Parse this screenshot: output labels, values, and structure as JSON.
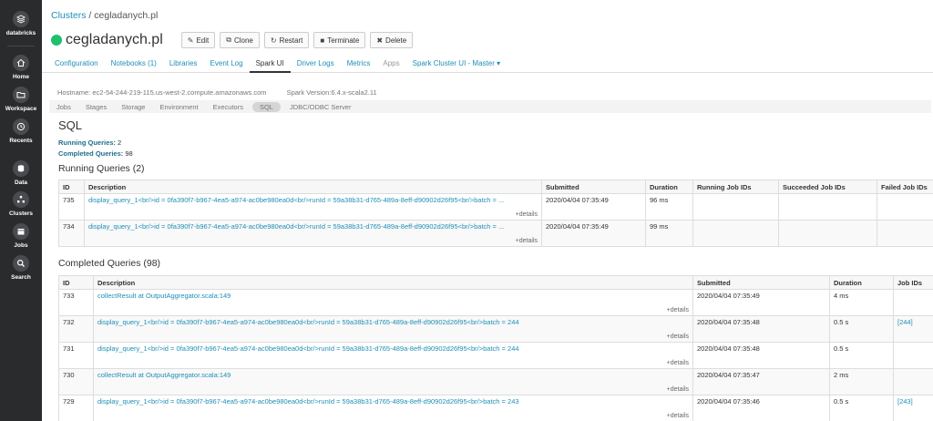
{
  "sidebar": {
    "items": [
      {
        "label": "databricks",
        "icon": "layers-icon"
      },
      {
        "label": "Home",
        "icon": "home-icon"
      },
      {
        "label": "Workspace",
        "icon": "folder-icon"
      },
      {
        "label": "Recents",
        "icon": "clock-icon"
      },
      {
        "label": "Data",
        "icon": "database-icon"
      },
      {
        "label": "Clusters",
        "icon": "cluster-icon"
      },
      {
        "label": "Jobs",
        "icon": "calendar-icon"
      },
      {
        "label": "Search",
        "icon": "search-icon"
      }
    ]
  },
  "breadcrumb": {
    "root": "Clusters",
    "separator": " / ",
    "current": "cegladanych.pl"
  },
  "cluster": {
    "name": "cegladanych.pl",
    "status_color": "#1ec16b",
    "buttons": {
      "edit": "Edit",
      "clone": "Clone",
      "restart": "Restart",
      "terminate": "Terminate",
      "delete": "Delete"
    }
  },
  "tabs": {
    "configuration": "Configuration",
    "notebooks": "Notebooks (1)",
    "libraries": "Libraries",
    "event_log": "Event Log",
    "spark_ui": "Spark UI",
    "driver_logs": "Driver Logs",
    "metrics": "Metrics",
    "apps": "Apps",
    "spark_master": "Spark Cluster UI - Master"
  },
  "host": {
    "hostname": "Hostname: ec2-54-244-219-115.us-west-2.compute.amazonaws.com",
    "version": "Spark Version:6.4.x-scala2.11"
  },
  "spark_nav": {
    "jobs": "Jobs",
    "stages": "Stages",
    "storage": "Storage",
    "environment": "Environment",
    "executors": "Executors",
    "sql": "SQL",
    "jdbc": "JDBC/ODBC Server"
  },
  "sql": {
    "title": "SQL",
    "running_label": "Running Queries:",
    "running_count": "2",
    "completed_label": "Completed Queries:",
    "completed_count": "98"
  },
  "running": {
    "title": "Running Queries (2)",
    "columns": [
      "ID",
      "Description",
      "Submitted",
      "Duration",
      "Running Job IDs",
      "Succeeded Job IDs",
      "Failed Job IDs"
    ],
    "rows": [
      {
        "id": "735",
        "desc": "display_query_1<br/>id = 0fa390f7-b967-4ea5-a974-ac0be980ea0d<br/>runId = 59a38b31-d765-489a-8eff-d90902d26f95<br/>batch = ...",
        "details": "+details",
        "submitted": "2020/04/04 07:35:49",
        "duration": "96 ms"
      },
      {
        "id": "734",
        "desc": "display_query_1<br/>id = 0fa390f7-b967-4ea5-a974-ac0be980ea0d<br/>runId = 59a38b31-d765-489a-8eff-d90902d26f95<br/>batch = ...",
        "details": "+details",
        "submitted": "2020/04/04 07:35:49",
        "duration": "99 ms"
      }
    ]
  },
  "completed": {
    "title": "Completed Queries (98)",
    "columns": [
      "ID",
      "Description",
      "Submitted",
      "Duration",
      "Job IDs"
    ],
    "rows": [
      {
        "id": "733",
        "desc": "collectResult at OutputAggregator.scala:149",
        "details": "+details",
        "submitted": "2020/04/04 07:35:49",
        "duration": "4 ms",
        "jobs": ""
      },
      {
        "id": "732",
        "desc": "display_query_1<br/>id = 0fa390f7-b967-4ea5-a974-ac0be980ea0d<br/>runId = 59a38b31-d765-489a-8eff-d90902d26f95<br/>batch = 244",
        "details": "+details",
        "submitted": "2020/04/04 07:35:48",
        "duration": "0.5 s",
        "jobs": "[244]"
      },
      {
        "id": "731",
        "desc": "display_query_1<br/>id = 0fa390f7-b967-4ea5-a974-ac0be980ea0d<br/>runId = 59a38b31-d765-489a-8eff-d90902d26f95<br/>batch = 244",
        "details": "+details",
        "submitted": "2020/04/04 07:35:48",
        "duration": "0.5 s",
        "jobs": ""
      },
      {
        "id": "730",
        "desc": "collectResult at OutputAggregator.scala:149",
        "details": "+details",
        "submitted": "2020/04/04 07:35:47",
        "duration": "2 ms",
        "jobs": ""
      },
      {
        "id": "729",
        "desc": "display_query_1<br/>id = 0fa390f7-b967-4ea5-a974-ac0be980ea0d<br/>runId = 59a38b31-d765-489a-8eff-d90902d26f95<br/>batch = 243",
        "details": "+details",
        "submitted": "2020/04/04 07:35:46",
        "duration": "0.5 s",
        "jobs": "[243]"
      }
    ]
  }
}
